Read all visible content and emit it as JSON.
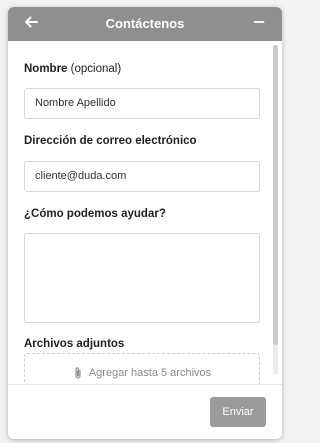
{
  "header": {
    "title": "Contáctenos",
    "back_icon": "arrow-left-icon",
    "minimize_icon": "minimize-icon"
  },
  "form": {
    "name_label": "Nombre",
    "name_optional": "(opcional)",
    "name_value": "Nombre Apellido",
    "email_label": "Dirección de correo electrónico",
    "email_value": "cliente@duda.com",
    "help_label": "¿Cómo podemos ayudar?",
    "help_value": "",
    "attachments_label": "Archivos adjuntos",
    "attachments_text": "Agregar hasta 5 archivos",
    "attach_icon": "paperclip-icon"
  },
  "footer": {
    "send_label": "Enviar"
  },
  "colors": {
    "header_bg": "#8e8f8f",
    "button_bg": "#9b9b9b"
  }
}
